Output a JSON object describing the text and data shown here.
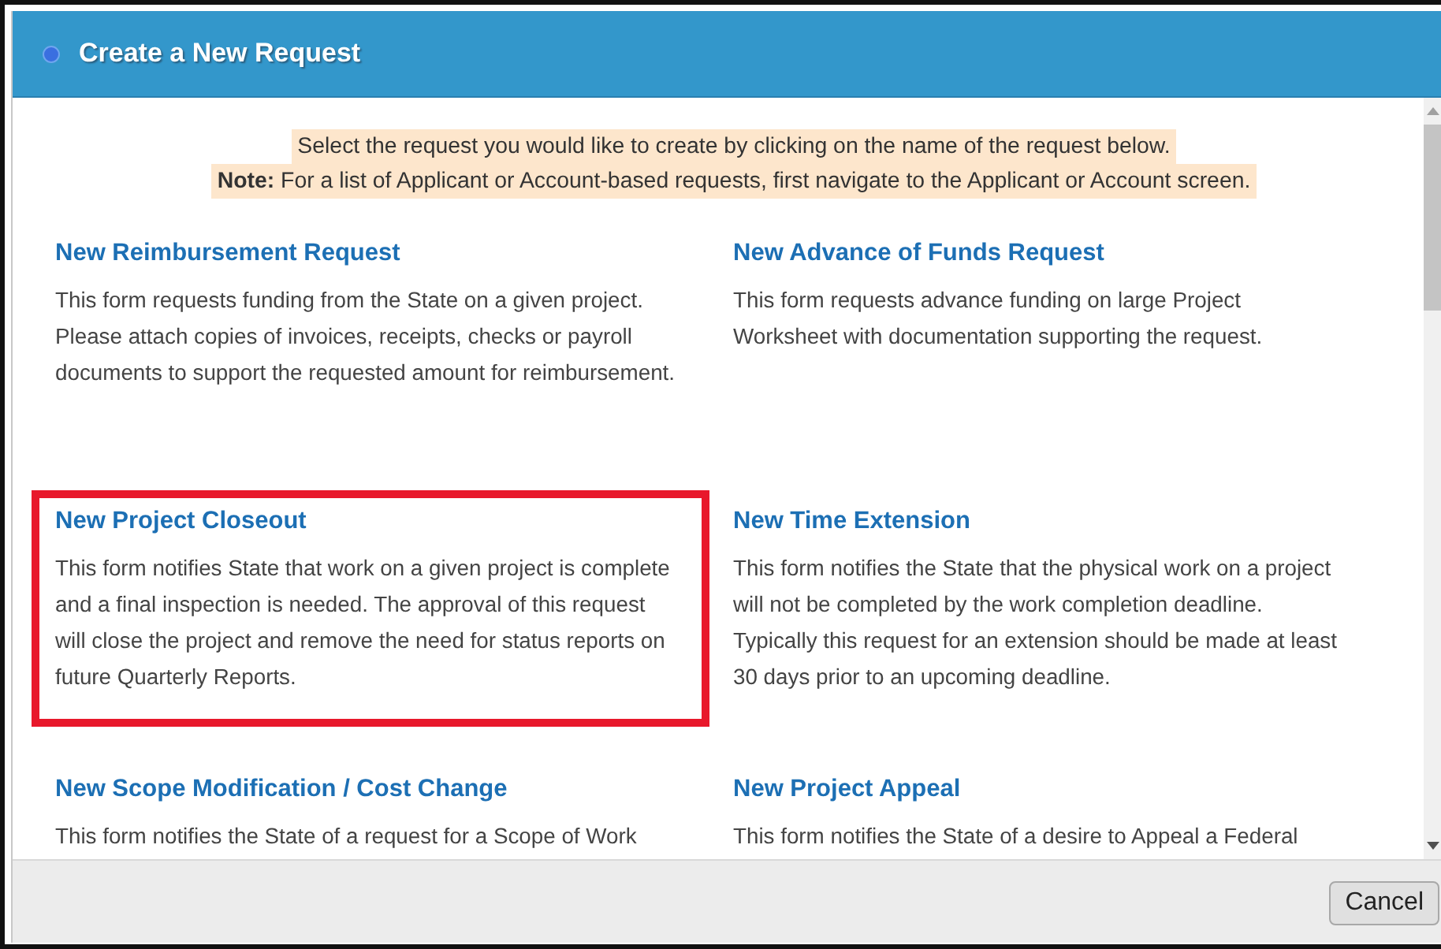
{
  "window": {
    "title": "Create a New Request"
  },
  "notice": {
    "line": "Select the request you would like to create by clicking on the name of the request below.",
    "note": "**Note:** For a list of Applicant or Account-based requests, first navigate to the Applicant or Account screen."
  },
  "requests": [
    {
      "title": "New Reimbursement Request",
      "description": "This form requests funding from the State on a given project. Please attach copies of invoices, receipts, checks or payroll documents to support the requested amount for reimbursement.",
      "highlighted": false
    },
    {
      "title": "New Advance of Funds Request",
      "description": "This form requests advance funding on large Project Worksheet with documentation supporting the request.",
      "highlighted": false
    },
    {
      "title": "New Project Closeout",
      "description": "This form notifies State that work on a given project is complete and a final inspection is needed. The approval of this request will close the project and remove the need for status reports on future Quarterly Reports.",
      "highlighted": true
    },
    {
      "title": "New Time Extension",
      "description": "This form notifies the State that the physical work on a project will not be completed by the work completion deadline. Typically this request for an extension should be made at least 30 days prior to an upcoming deadline.",
      "highlighted": false
    },
    {
      "title": "New Scope Modification / Cost Change",
      "description": "This form notifies the State of a request for a Scope of Work",
      "highlighted": false
    },
    {
      "title": "New Project Appeal",
      "description": "This form notifies the State of a desire to Appeal a Federal",
      "highlighted": false
    }
  ],
  "buttons": [
    {
      "label": "Cancel"
    }
  ]
}
